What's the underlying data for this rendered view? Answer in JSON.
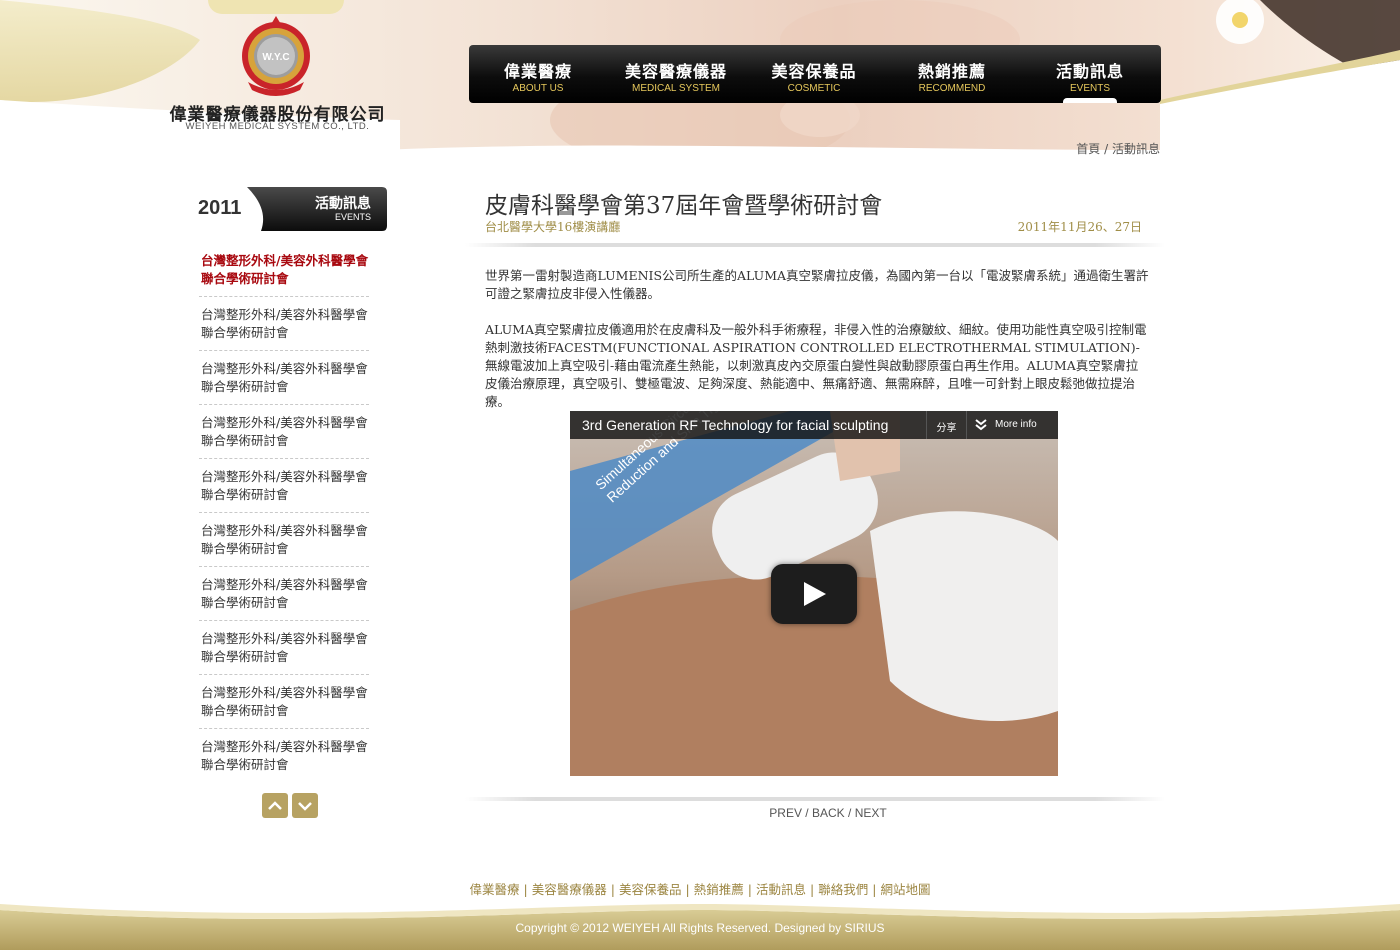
{
  "brand": {
    "seal_text": "W.Y.C",
    "name": "偉業醫療儀器股份有限公司",
    "name_en": "WEIYEH MEDICAL SYSTEM CO., LTD."
  },
  "nav": [
    {
      "zh": "偉業醫療",
      "en": "ABOUT US"
    },
    {
      "zh": "美容醫療儀器",
      "en": "MEDICAL SYSTEM"
    },
    {
      "zh": "美容保養品",
      "en": "COSMETIC"
    },
    {
      "zh": "熱銷推薦",
      "en": "RECOMMEND"
    },
    {
      "zh": "活動訊息",
      "en": "EVENTS",
      "active": true
    }
  ],
  "breadcrumb": {
    "home": "首頁",
    "separator": " / ",
    "current": "活動訊息"
  },
  "sidebar": {
    "year": "2011",
    "tab_zh": "活動訊息",
    "tab_en": "EVENTS",
    "items": [
      {
        "label": "台灣整形外科/美容外科醫學會聯合學術研討會",
        "active": true
      },
      {
        "label": "台灣整形外科/美容外科醫學會聯合學術研討會"
      },
      {
        "label": "台灣整形外科/美容外科醫學會聯合學術研討會"
      },
      {
        "label": "台灣整形外科/美容外科醫學會聯合學術研討會"
      },
      {
        "label": "台灣整形外科/美容外科醫學會聯合學術研討會"
      },
      {
        "label": "台灣整形外科/美容外科醫學會聯合學術研討會"
      },
      {
        "label": "台灣整形外科/美容外科醫學會聯合學術研討會"
      },
      {
        "label": "台灣整形外科/美容外科醫學會聯合學術研討會"
      },
      {
        "label": "台灣整形外科/美容外科醫學會聯合學術研討會"
      },
      {
        "label": "台灣整形外科/美容外科醫學會聯合學術研討會"
      }
    ],
    "pager_up_icon": "chevron-up-icon",
    "pager_down_icon": "chevron-down-icon"
  },
  "article": {
    "title": "皮膚科醫學會第37屆年會暨學術研討會",
    "venue": "台北醫學大學16樓演講廳",
    "date": "2011年11月26、27日",
    "paragraph1": "世界第一雷射製造商LUMENIS公司所生產的ALUMA真空緊膚拉皮儀，為國內第一台以「電波緊膚系統」通過衛生署許可證之緊膚拉皮非侵入性儀器。",
    "paragraph2": "ALUMA真空緊膚拉皮儀適用於在皮膚科及一般外科手術療程，非侵入性的治療皺紋、細紋。使用功能性真空吸引控制電熱刺激技術FACESTM(FUNCTIONAL ASPIRATION CONTROLLED ELECTROTHERMAL STIMULATION)-無線電波加上真空吸引-藉由電流產生熱能，以刺激真皮內交原蛋白變性與啟動膠原蛋白再生作用。ALUMA真空緊膚拉皮儀治療原理，真空吸引、雙極電波、足夠深度、熱能適中、無痛舒適、無需麻醉，且唯一可針對上眼皮鬆弛做拉提治療。"
  },
  "video": {
    "title": "3rd Generation RF Technology for facial sculpting",
    "share": "分享",
    "more_info": "More info",
    "caption_line1": "Simultaneous Circumference",
    "caption_line2": "Reduction and Skin Tightening"
  },
  "post_nav": {
    "prev": "PREV",
    "back": "BACK",
    "next": "NEXT",
    "separator": " / "
  },
  "footer": {
    "links": [
      "偉業醫療",
      "美容醫療儀器",
      "美容保養品",
      "熱銷推薦",
      "活動訊息",
      "聯絡我們",
      "網站地圖"
    ],
    "separator": "|",
    "copyright": "Copyright © 2012 WEIYEH All Rights Reserved. Designed by SIRIUS"
  },
  "colors": {
    "gold": "#a08e48",
    "active_red": "#a8080f",
    "nav_en": "#e6c85c",
    "footer_band": "#b8a86a"
  }
}
